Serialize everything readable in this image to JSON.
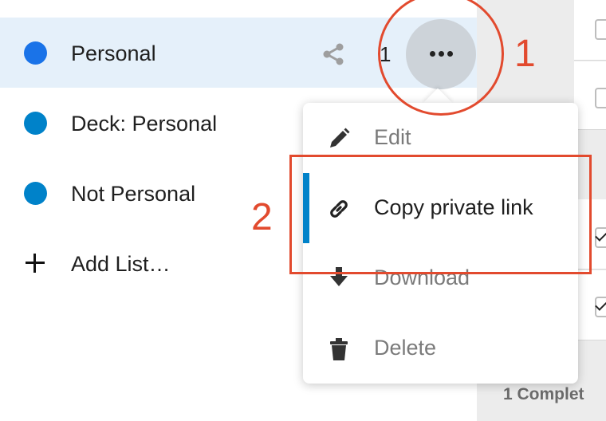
{
  "sidebar": {
    "lists": [
      {
        "label": "Personal",
        "color": "#1a73e8",
        "active": true,
        "share_icon": "share-icon",
        "count": "1"
      },
      {
        "label": "Deck: Personal",
        "color": "#0082c9",
        "active": false
      },
      {
        "label": "Not Personal",
        "color": "#0082c9",
        "active": false
      }
    ],
    "add_list_label": "Add List…",
    "more_button_icon": "more-horizontal-icon"
  },
  "menu": {
    "items": [
      {
        "label": "Edit",
        "icon": "pencil-icon",
        "state": "normal"
      },
      {
        "label": "Copy private link",
        "icon": "link-icon",
        "state": "highlighted"
      },
      {
        "label": "Download",
        "icon": "download-icon",
        "state": "normal"
      },
      {
        "label": "Delete",
        "icon": "trash-icon",
        "state": "normal"
      }
    ]
  },
  "right_panel": {
    "completed_label": "1 Complet"
  },
  "annotations": {
    "marker_1": "1",
    "marker_2": "2",
    "color": "#e24a2e"
  },
  "colors": {
    "accent": "#0082c9",
    "active_row_bg": "#e5f0fa"
  }
}
